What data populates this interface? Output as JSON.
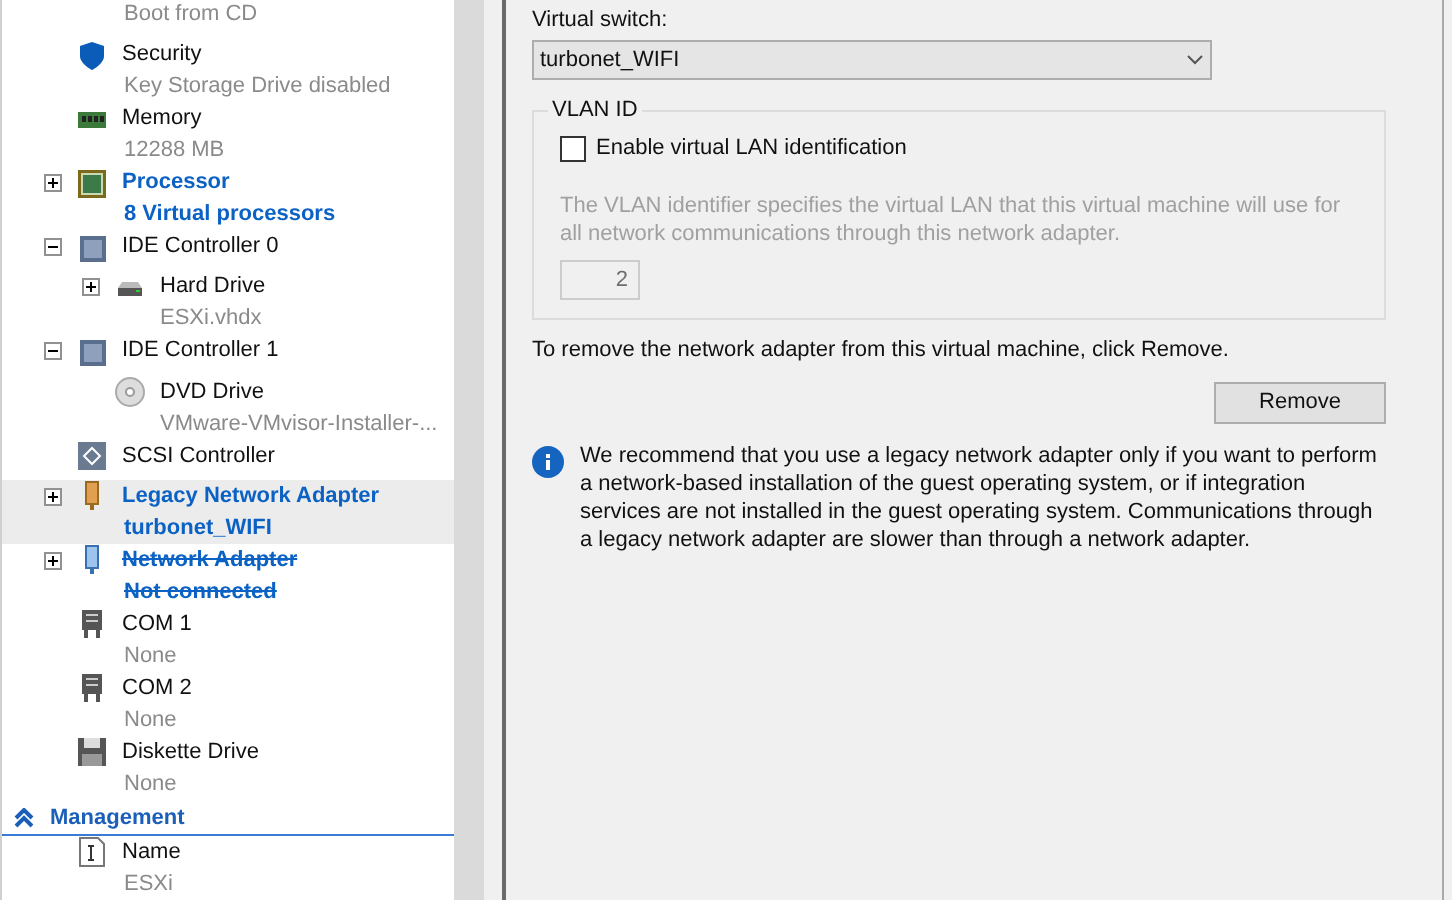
{
  "hardware_tree": {
    "items": [
      {
        "value": "Boot from CD"
      },
      {
        "kind": "security",
        "name": "Security",
        "value": "Key Storage Drive disabled"
      },
      {
        "kind": "memory",
        "name": "Memory",
        "value": "12288 MB"
      },
      {
        "kind": "processor",
        "name": "Processor",
        "value": "8 Virtual processors",
        "expanded": false,
        "pending": true,
        "removed": false,
        "selected": false
      },
      {
        "kind": "controller",
        "name": "IDE Controller 0",
        "expanded": true,
        "children": [
          {
            "kind": "disk",
            "name": "Hard Drive",
            "value": "ESXi.vhdx",
            "expanded": false
          }
        ]
      },
      {
        "kind": "controller",
        "name": "IDE Controller 1",
        "expanded": true,
        "children": [
          {
            "kind": "dvd",
            "name": "DVD Drive",
            "value": "VMware-VMvisor-Installer-..."
          }
        ]
      },
      {
        "kind": "scsi",
        "name": "SCSI Controller"
      },
      {
        "kind": "legacy_nic",
        "name": "Legacy Network Adapter",
        "value": "turbonet_WIFI",
        "expanded": false,
        "pending": true,
        "removed": false,
        "selected": true
      },
      {
        "kind": "nic",
        "name": "Network Adapter",
        "value": "Not connected",
        "expanded": false,
        "pending": true,
        "removed": true,
        "selected": false
      },
      {
        "kind": "com",
        "name": "COM 1",
        "value": "None"
      },
      {
        "kind": "com",
        "name": "COM 2",
        "value": "None"
      },
      {
        "kind": "diskette",
        "name": "Diskette Drive",
        "value": "None"
      }
    ],
    "section": {
      "title": "Management",
      "expanded": true
    },
    "management_items": [
      {
        "kind": "name",
        "name": "Name",
        "value": "ESXi"
      }
    ]
  },
  "adapter_settings": {
    "virtual_switch": {
      "label": "Virtual switch:",
      "value": "turbonet_WIFI"
    },
    "vlan": {
      "title": "VLAN ID",
      "checkbox": {
        "label": "Enable virtual LAN identification",
        "checked": false
      },
      "description": "The VLAN identifier specifies the virtual LAN that this virtual machine will use for all network communications through this network adapter.",
      "id_value": "2",
      "disabled": true
    },
    "remove_hint": "To remove the network adapter from this virtual machine, click Remove.",
    "remove_button": "Remove",
    "info": "We recommend that you use a legacy network adapter only if you want to perform a network-based installation of the guest operating system, or if integration services are not installed in the guest operating system. Communications through a legacy network adapter are slower than through a network adapter."
  }
}
